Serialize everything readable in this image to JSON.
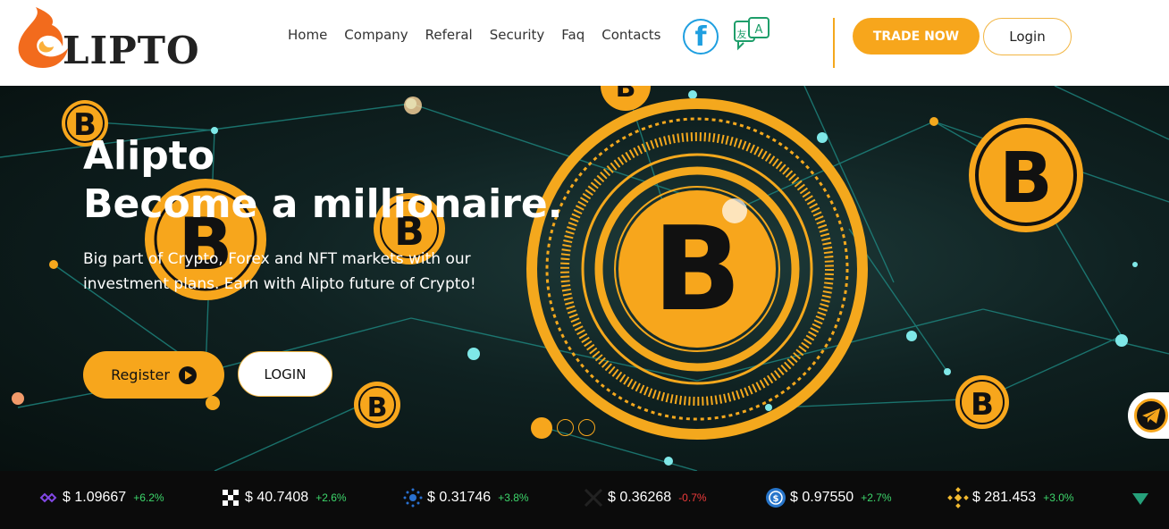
{
  "header": {
    "logo_text": "LIPTO",
    "nav": [
      "Home",
      "Company",
      "Referal",
      "Security",
      "Faq",
      "Contacts"
    ],
    "trade_label": "TRADE NOW",
    "login_label": "Login"
  },
  "hero": {
    "title_line1": "Alipto",
    "title_line2": "Become a millionaire.",
    "subtitle": "Big part of Crypto, Forex and NFT markets with our investment plans. Earn with Alipto future of Crypto!",
    "register_label": "Register",
    "login_label": "LOGIN",
    "coin_letter": "B"
  },
  "ticker": [
    {
      "icon": "polygon-icon",
      "price": "$ 1.09667",
      "change": "+6.2%",
      "dir": "up"
    },
    {
      "icon": "okb-icon",
      "price": "$ 40.7408",
      "change": "+2.6%",
      "dir": "up"
    },
    {
      "icon": "cardano-icon",
      "price": "$ 0.31746",
      "change": "+3.8%",
      "dir": "up"
    },
    {
      "icon": "xrp-icon",
      "price": "$ 0.36268",
      "change": "-0.7%",
      "dir": "down"
    },
    {
      "icon": "usdc-icon",
      "price": "$ 0.97550",
      "change": "+2.7%",
      "dir": "up"
    },
    {
      "icon": "bnb-icon",
      "price": "$ 281.453",
      "change": "+3.0%",
      "dir": "up"
    }
  ],
  "colors": {
    "accent": "#f7a61c",
    "up": "#3dd66b",
    "down": "#ef3b3b"
  }
}
